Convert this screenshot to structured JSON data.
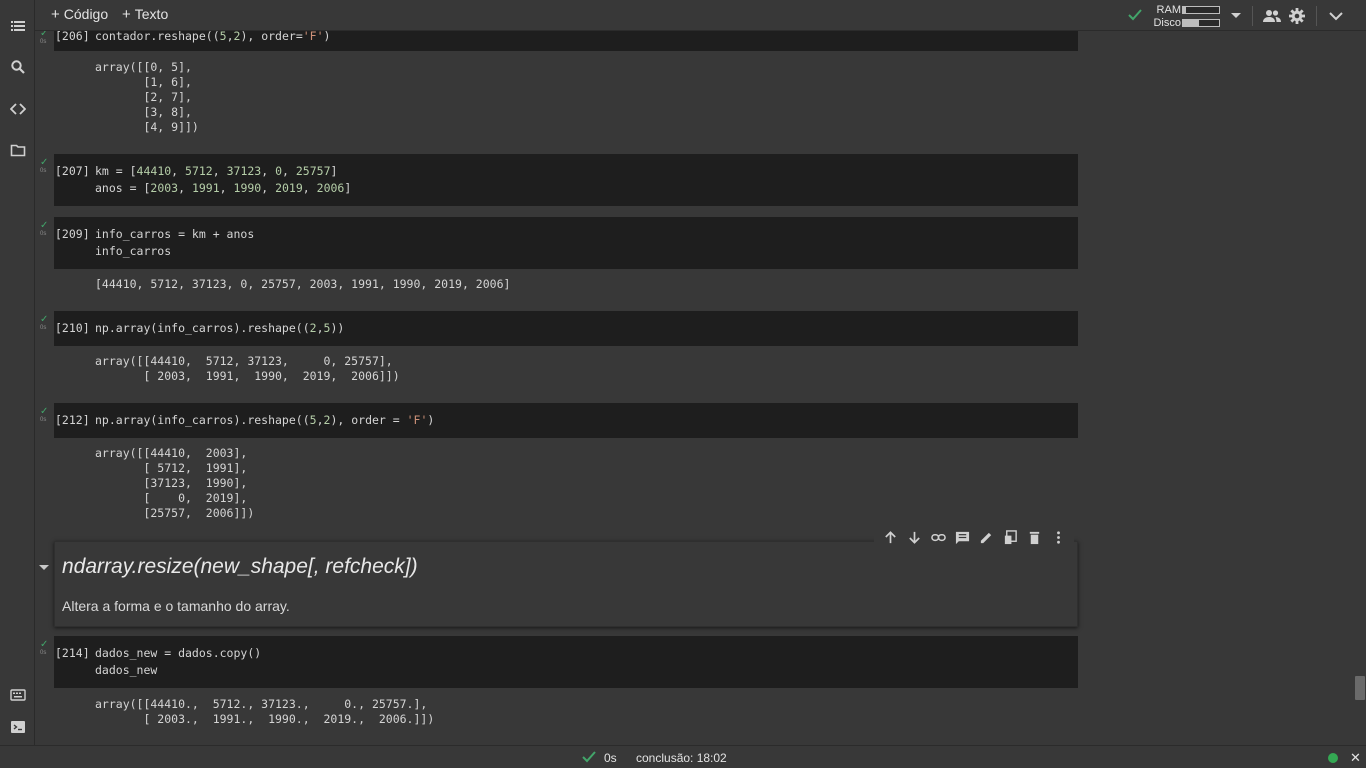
{
  "toolbar": {
    "add_code": "Código",
    "add_text": "Texto",
    "ram_label": "RAM",
    "disk_label": "Disco",
    "ram_usage": 0.08,
    "disk_usage": 0.45
  },
  "rail_icons": [
    "table-of-contents-icon",
    "search-icon",
    "code-snippets-icon",
    "files-icon",
    "command-palette-icon",
    "terminal-icon"
  ],
  "cells": [
    {
      "exec_count": "[206]",
      "time": "0s",
      "code": "contador.reshape((5,2), order='F')",
      "output": "array([[0, 5],\n       [1, 6],\n       [2, 7],\n       [3, 8],\n       [4, 9]])"
    },
    {
      "exec_count": "[207]",
      "time": "0s",
      "code_line1": "km = [44410, 5712, 37123, 0, 25757]",
      "code_line2": "anos = [2003, 1991, 1990, 2019, 2006]"
    },
    {
      "exec_count": "[209]",
      "time": "0s",
      "code_line1": "info_carros = km + anos",
      "code_line2": "info_carros",
      "output": "[44410, 5712, 37123, 0, 25757, 2003, 1991, 1990, 2019, 2006]"
    },
    {
      "exec_count": "[210]",
      "time": "0s",
      "code": "np.array(info_carros).reshape((2,5))",
      "output": "array([[44410,  5712, 37123,     0, 25757],\n       [ 2003,  1991,  1990,  2019,  2006]])"
    },
    {
      "exec_count": "[212]",
      "time": "0s",
      "code": "np.array(info_carros).reshape((5,2), order = 'F')",
      "output": "array([[44410,  2003],\n       [ 5712,  1991],\n       [37123,  1990],\n       [    0,  2019],\n       [25757,  2006]])"
    },
    {
      "exec_count": "[214]",
      "time": "0s",
      "code_line1": "dados_new = dados.copy()",
      "code_line2": "dados_new",
      "output": "array([[44410.,  5712., 37123.,     0., 25757.],\n       [ 2003.,  1991.,  1990.,  2019.,  2006.]])"
    }
  ],
  "text_cell": {
    "heading": "ndarray.resize(new_shape[, refcheck])",
    "body": "Altera a forma e o tamanho do array."
  },
  "cell_tools": [
    "move-up-icon",
    "move-down-icon",
    "link-icon",
    "comment-icon",
    "edit-icon",
    "mirror-cell-icon",
    "delete-icon",
    "more-icon"
  ],
  "statusbar": {
    "time": "0s",
    "completion": "conclusão: 18:02"
  }
}
